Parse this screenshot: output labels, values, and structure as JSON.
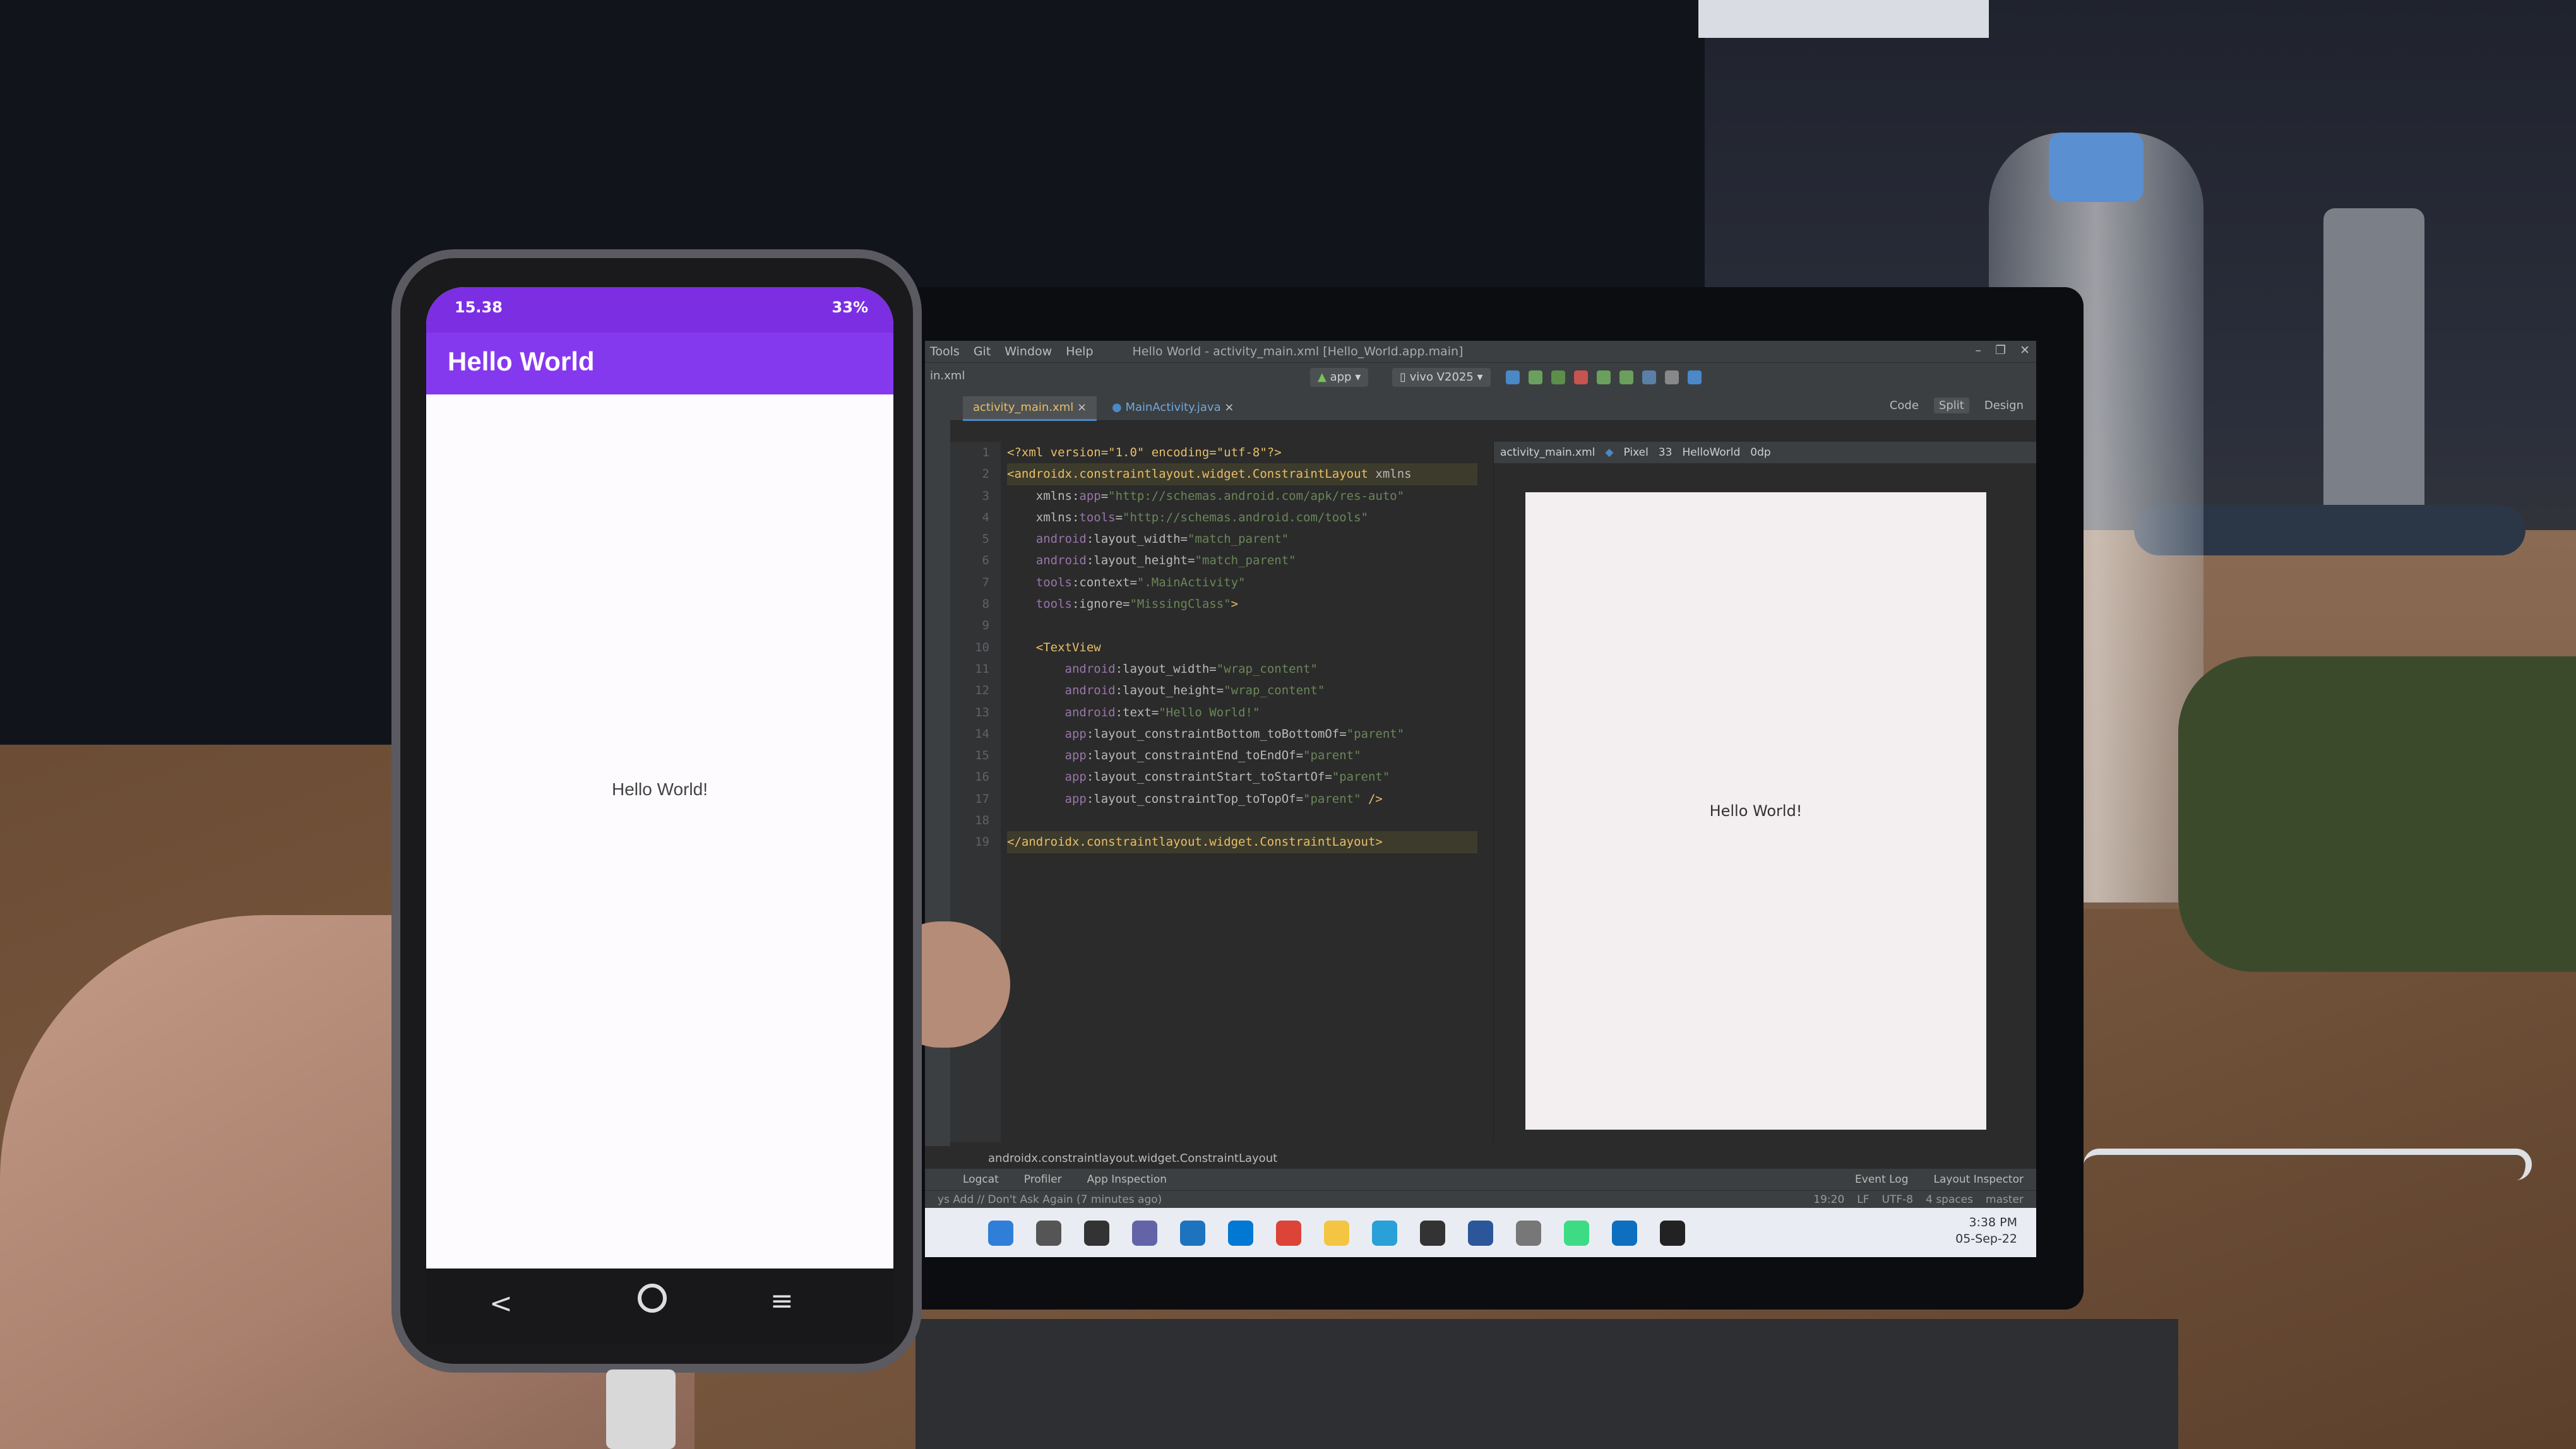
{
  "ide": {
    "menu": [
      "Tools",
      "Git",
      "Window",
      "Help"
    ],
    "window_title": "Hello World - activity_main.xml [Hello_World.app.main]",
    "file_label": "in.xml",
    "run_config": "app",
    "device": "vivo V2025",
    "tabs": [
      {
        "label": "activity_main.xml",
        "active": true
      },
      {
        "label": "MainActivity.java",
        "active": false
      }
    ],
    "view_modes": [
      "Code",
      "Split",
      "Design"
    ],
    "code_lines": [
      {
        "n": "1",
        "parts": [
          [
            "tag",
            "<?xml version=\"1.0\" encoding=\"utf-8\"?>"
          ]
        ]
      },
      {
        "n": "2",
        "parts": [
          [
            "tag",
            "<androidx.constraintlayout.widget.ConstraintLayout"
          ],
          [
            "attr",
            " xmlns"
          ]
        ]
      },
      {
        "n": "3",
        "parts": [
          [
            "attr",
            "    xmlns:"
          ],
          [
            "ns",
            "app"
          ],
          [
            "attr",
            "="
          ],
          [
            "val",
            "\"http://schemas.android.com/apk/res-auto\""
          ]
        ]
      },
      {
        "n": "4",
        "parts": [
          [
            "attr",
            "    xmlns:"
          ],
          [
            "ns",
            "tools"
          ],
          [
            "attr",
            "="
          ],
          [
            "val",
            "\"http://schemas.android.com/tools\""
          ]
        ]
      },
      {
        "n": "5",
        "parts": [
          [
            "ns",
            "    android"
          ],
          [
            "attr",
            ":layout_width="
          ],
          [
            "val",
            "\"match_parent\""
          ]
        ]
      },
      {
        "n": "6",
        "parts": [
          [
            "ns",
            "    android"
          ],
          [
            "attr",
            ":layout_height="
          ],
          [
            "val",
            "\"match_parent\""
          ]
        ]
      },
      {
        "n": "7",
        "parts": [
          [
            "ns",
            "    tools"
          ],
          [
            "attr",
            ":context="
          ],
          [
            "val",
            "\".MainActivity\""
          ]
        ]
      },
      {
        "n": "8",
        "parts": [
          [
            "ns",
            "    tools"
          ],
          [
            "attr",
            ":ignore="
          ],
          [
            "val",
            "\"MissingClass\""
          ],
          [
            "tag",
            ">"
          ]
        ]
      },
      {
        "n": "9",
        "parts": [
          [
            "attr",
            ""
          ]
        ]
      },
      {
        "n": "10",
        "parts": [
          [
            "tag",
            "    <TextView"
          ]
        ]
      },
      {
        "n": "11",
        "parts": [
          [
            "ns",
            "        android"
          ],
          [
            "attr",
            ":layout_width="
          ],
          [
            "val",
            "\"wrap_content\""
          ]
        ]
      },
      {
        "n": "12",
        "parts": [
          [
            "ns",
            "        android"
          ],
          [
            "attr",
            ":layout_height="
          ],
          [
            "val",
            "\"wrap_content\""
          ]
        ]
      },
      {
        "n": "13",
        "parts": [
          [
            "ns",
            "        android"
          ],
          [
            "attr",
            ":text="
          ],
          [
            "val",
            "\"Hello World!\""
          ]
        ]
      },
      {
        "n": "14",
        "parts": [
          [
            "ns",
            "        app"
          ],
          [
            "attr",
            ":layout_constraintBottom_toBottomOf="
          ],
          [
            "val",
            "\"parent\""
          ]
        ]
      },
      {
        "n": "15",
        "parts": [
          [
            "ns",
            "        app"
          ],
          [
            "attr",
            ":layout_constraintEnd_toEndOf="
          ],
          [
            "val",
            "\"parent\""
          ]
        ]
      },
      {
        "n": "16",
        "parts": [
          [
            "ns",
            "        app"
          ],
          [
            "attr",
            ":layout_constraintStart_toStartOf="
          ],
          [
            "val",
            "\"parent\""
          ]
        ]
      },
      {
        "n": "17",
        "parts": [
          [
            "ns",
            "        app"
          ],
          [
            "attr",
            ":layout_constraintTop_toTopOf="
          ],
          [
            "val",
            "\"parent\""
          ],
          [
            "tag",
            " />"
          ]
        ]
      },
      {
        "n": "18",
        "parts": [
          [
            "attr",
            ""
          ]
        ]
      },
      {
        "n": "19",
        "parts": [
          [
            "tag",
            "</androidx.constraintlayout.widget.ConstraintLayout>"
          ]
        ]
      }
    ],
    "breadcrumb": "androidx.constraintlayout.widget.ConstraintLayout",
    "design_toolbar": {
      "file": "activity_main.xml",
      "device": "Pixel",
      "api": "33",
      "theme": "HelloWorld",
      "margin": "0dp"
    },
    "preview_text": "Hello World!",
    "bottom_tools": [
      "Logcat",
      "Profiler",
      "App Inspection"
    ],
    "bottom_right": [
      "Event Log",
      "Layout Inspector"
    ],
    "status_message": "ys Add // Don't Ask Again (7 minutes ago)",
    "status_right": [
      "19:20",
      "LF",
      "UTF-8",
      "4 spaces",
      "master"
    ],
    "clock_time": "3:38 PM",
    "clock_date": "05-Sep-22"
  },
  "phone": {
    "status_time": "15.38",
    "status_battery": "33%",
    "app_title": "Hello World",
    "content_text": "Hello World!",
    "nav": {
      "back": "<",
      "menu": "≡"
    }
  },
  "colors": {
    "app_bar": "#8539ee",
    "status_bar": "#7c2ee3",
    "ide_bg": "#2b2b2b",
    "xml_tag": "#e8bf6a",
    "xml_value": "#6a8759"
  }
}
